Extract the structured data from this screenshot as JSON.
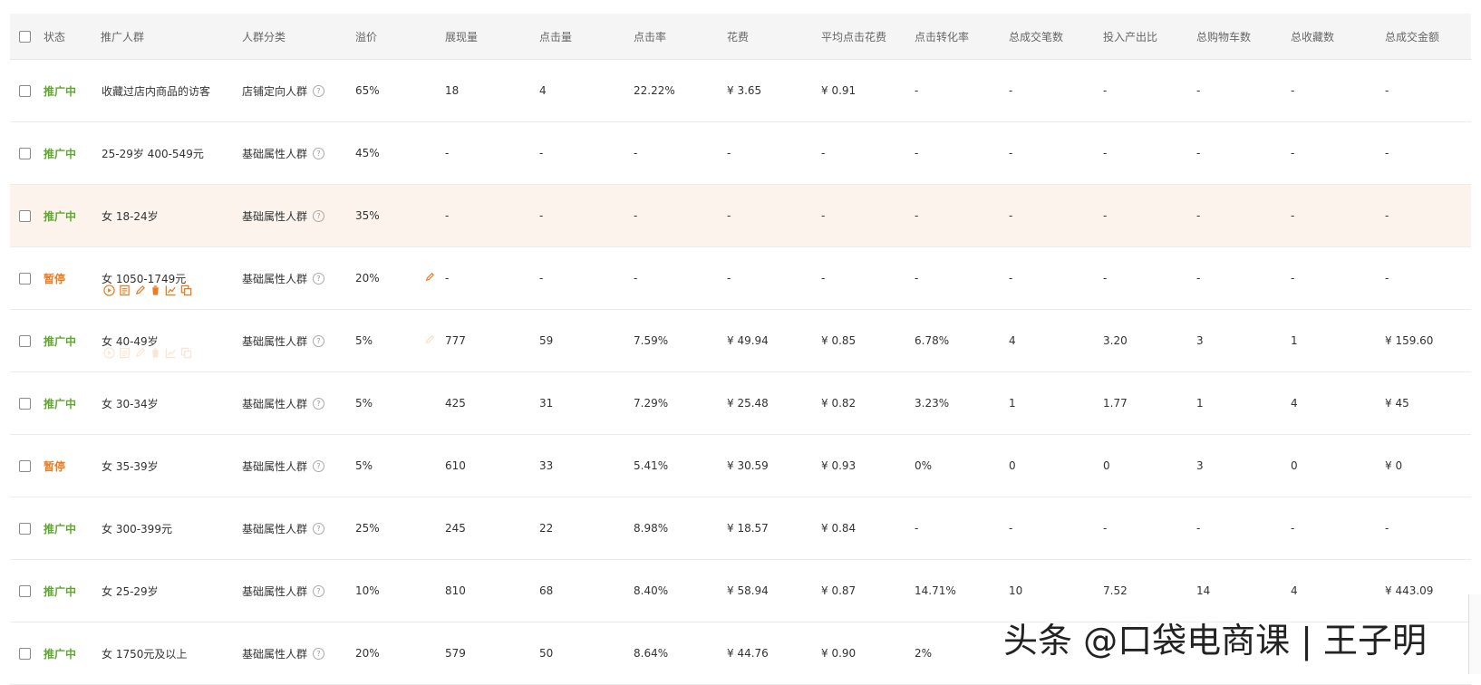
{
  "headers": {
    "status": "状态",
    "crowd": "推广人群",
    "category": "人群分类",
    "premium": "溢价",
    "impressions": "展现量",
    "clicks": "点击量",
    "ctr": "点击率",
    "cost": "花费",
    "cpc": "平均点击花费",
    "cvr": "点击转化率",
    "orders": "总成交笔数",
    "roi": "投入产出比",
    "cart": "总购物车数",
    "fav": "总收藏数",
    "amount": "总成交金额"
  },
  "help_glyph": "?",
  "rows": [
    {
      "status": "推广中",
      "status_type": "active",
      "crowd": "收藏过店内商品的访客",
      "category": "店铺定向人群",
      "premium": "65%",
      "impressions": "18",
      "clicks": "4",
      "ctr": "22.22%",
      "cost": "¥ 3.65",
      "cpc": "¥ 0.91",
      "cvr": "-",
      "orders": "-",
      "roi": "-",
      "cart": "-",
      "fav": "-",
      "amount": "-"
    },
    {
      "status": "推广中",
      "status_type": "active",
      "crowd": "25-29岁 400-549元",
      "category": "基础属性人群",
      "premium": "45%",
      "impressions": "-",
      "clicks": "-",
      "ctr": "-",
      "cost": "-",
      "cpc": "-",
      "cvr": "-",
      "orders": "-",
      "roi": "-",
      "cart": "-",
      "fav": "-",
      "amount": "-"
    },
    {
      "status": "推广中",
      "status_type": "active",
      "crowd": "女 18-24岁",
      "category": "基础属性人群",
      "premium": "35%",
      "impressions": "-",
      "clicks": "-",
      "ctr": "-",
      "cost": "-",
      "cpc": "-",
      "cvr": "-",
      "orders": "-",
      "roi": "-",
      "cart": "-",
      "fav": "-",
      "amount": "-"
    },
    {
      "status": "暂停",
      "status_type": "paused",
      "crowd": "女 1050-1749元",
      "category": "基础属性人群",
      "premium": "20%",
      "impressions": "-",
      "clicks": "-",
      "ctr": "-",
      "cost": "-",
      "cpc": "-",
      "cvr": "-",
      "orders": "-",
      "roi": "-",
      "cart": "-",
      "fav": "-",
      "amount": "-"
    },
    {
      "status": "推广中",
      "status_type": "active",
      "crowd": "女 40-49岁",
      "category": "基础属性人群",
      "premium": "5%",
      "impressions": "777",
      "clicks": "59",
      "ctr": "7.59%",
      "cost": "¥ 49.94",
      "cpc": "¥ 0.85",
      "cvr": "6.78%",
      "orders": "4",
      "roi": "3.20",
      "cart": "3",
      "fav": "1",
      "amount": "¥ 159.60"
    },
    {
      "status": "推广中",
      "status_type": "active",
      "crowd": "女 30-34岁",
      "category": "基础属性人群",
      "premium": "5%",
      "impressions": "425",
      "clicks": "31",
      "ctr": "7.29%",
      "cost": "¥ 25.48",
      "cpc": "¥ 0.82",
      "cvr": "3.23%",
      "orders": "1",
      "roi": "1.77",
      "cart": "1",
      "fav": "4",
      "amount": "¥ 45"
    },
    {
      "status": "暂停",
      "status_type": "paused",
      "crowd": "女 35-39岁",
      "category": "基础属性人群",
      "premium": "5%",
      "impressions": "610",
      "clicks": "33",
      "ctr": "5.41%",
      "cost": "¥ 30.59",
      "cpc": "¥ 0.93",
      "cvr": "0%",
      "orders": "0",
      "roi": "0",
      "cart": "3",
      "fav": "0",
      "amount": "¥ 0"
    },
    {
      "status": "推广中",
      "status_type": "active",
      "crowd": "女 300-399元",
      "category": "基础属性人群",
      "premium": "25%",
      "impressions": "245",
      "clicks": "22",
      "ctr": "8.98%",
      "cost": "¥ 18.57",
      "cpc": "¥ 0.84",
      "cvr": "-",
      "orders": "-",
      "roi": "-",
      "cart": "-",
      "fav": "-",
      "amount": "-"
    },
    {
      "status": "推广中",
      "status_type": "active",
      "crowd": "女 25-29岁",
      "category": "基础属性人群",
      "premium": "10%",
      "impressions": "810",
      "clicks": "68",
      "ctr": "8.40%",
      "cost": "¥ 58.94",
      "cpc": "¥ 0.87",
      "cvr": "14.71%",
      "orders": "10",
      "roi": "7.52",
      "cart": "14",
      "fav": "4",
      "amount": "¥ 443.09"
    },
    {
      "status": "推广中",
      "status_type": "active",
      "crowd": "女 1750元及以上",
      "category": "基础属性人群",
      "premium": "20%",
      "impressions": "579",
      "clicks": "50",
      "ctr": "8.64%",
      "cost": "¥ 44.76",
      "cpc": "¥ 0.90",
      "cvr": "2%",
      "orders": "",
      "roi": "",
      "cart": "",
      "fav": "",
      "amount": ""
    }
  ],
  "watermark": "头条 @口袋电商课 | 王子明",
  "colors": {
    "active": "#5ea82e",
    "paused": "#ee7b21",
    "highlight": "#fbf3ec",
    "header_bg": "#f5f5f5"
  }
}
